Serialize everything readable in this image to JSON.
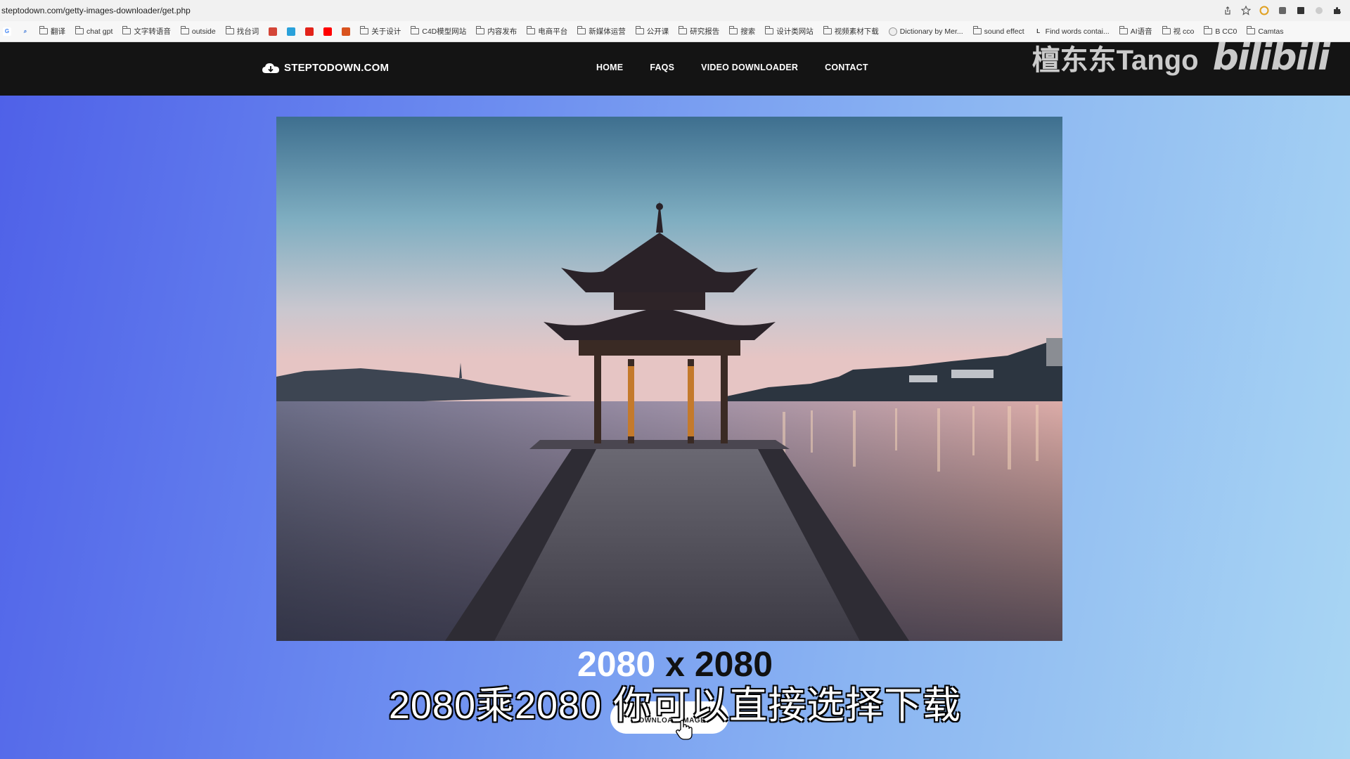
{
  "browser": {
    "url": "steptodown.com/getty-images-downloader/get.php",
    "bookmarks": [
      {
        "label": "",
        "type": "google"
      },
      {
        "label": "",
        "type": "search"
      },
      {
        "label": "翻译",
        "type": "folder"
      },
      {
        "label": "chat gpt",
        "type": "folder"
      },
      {
        "label": "文字转语音",
        "type": "folder"
      },
      {
        "label": "outside",
        "type": "folder"
      },
      {
        "label": "找台词",
        "type": "folder"
      },
      {
        "label": "",
        "type": "gmail"
      },
      {
        "label": "",
        "type": "telegram"
      },
      {
        "label": "",
        "type": "red"
      },
      {
        "label": "",
        "type": "youtube"
      },
      {
        "label": "",
        "type": "orange"
      },
      {
        "label": "关于设计",
        "type": "folder"
      },
      {
        "label": "C4D模型网站",
        "type": "folder"
      },
      {
        "label": "内容发布",
        "type": "folder"
      },
      {
        "label": "电商平台",
        "type": "folder"
      },
      {
        "label": "新媒体运营",
        "type": "folder"
      },
      {
        "label": "公开课",
        "type": "folder"
      },
      {
        "label": "研究报告",
        "type": "folder"
      },
      {
        "label": "搜索",
        "type": "folder"
      },
      {
        "label": "设计类网站",
        "type": "folder"
      },
      {
        "label": "视频素材下载",
        "type": "folder"
      },
      {
        "label": "Dictionary by Mer...",
        "type": "site"
      },
      {
        "label": "sound effect",
        "type": "folder"
      },
      {
        "label": "Find words contai...",
        "type": "letter"
      },
      {
        "label": "AI语音",
        "type": "folder"
      },
      {
        "label": "视 cco",
        "type": "folder"
      },
      {
        "label": "B CC0",
        "type": "folder"
      },
      {
        "label": "Camtas",
        "type": "folder"
      }
    ]
  },
  "site": {
    "logo": "STEPTODOWN.COM",
    "nav": [
      "HOME",
      "FAQS",
      "VIDEO DOWNLOADER",
      "CONTACT"
    ]
  },
  "watermark": {
    "author": "檀东东Tango",
    "platform": "bilibili"
  },
  "content": {
    "dims_w": "2080",
    "dims_x": "x",
    "dims_h": "2080",
    "subtitle": "2080乘2080 你可以直接选择下载",
    "download_button": "DOWNLOAD IMAGE"
  },
  "colors": {
    "header_bg": "#141414",
    "gradient_left": "#4f61e8",
    "gradient_right": "#a9d6f3"
  }
}
